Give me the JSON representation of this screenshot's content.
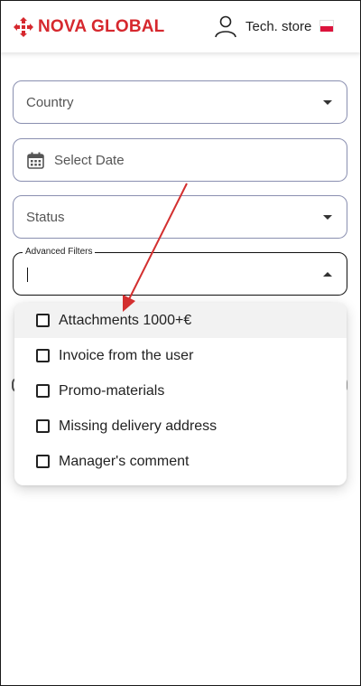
{
  "header": {
    "brand": "NOVA GLOBAL",
    "user_label": "Tech. store",
    "logo_icon": "nova-logo-icon",
    "user_icon": "user-icon",
    "flag": "poland-flag-icon",
    "brand_color": "#d6282e"
  },
  "form": {
    "country": {
      "placeholder": "Country"
    },
    "date": {
      "placeholder": "Select Date"
    },
    "status": {
      "placeholder": "Status"
    },
    "advanced_filters": {
      "label": "Advanced Filters",
      "value": ""
    }
  },
  "dropdown": {
    "options": [
      {
        "label": "Attachments 1000+€",
        "checked": false,
        "highlighted": true
      },
      {
        "label": "Invoice from the user",
        "checked": false
      },
      {
        "label": "Promo-materials",
        "checked": false
      },
      {
        "label": "Missing delivery address",
        "checked": false
      },
      {
        "label": "Manager's comment",
        "checked": false
      }
    ]
  },
  "annotation": {
    "arrow_color": "#d32f2f"
  }
}
